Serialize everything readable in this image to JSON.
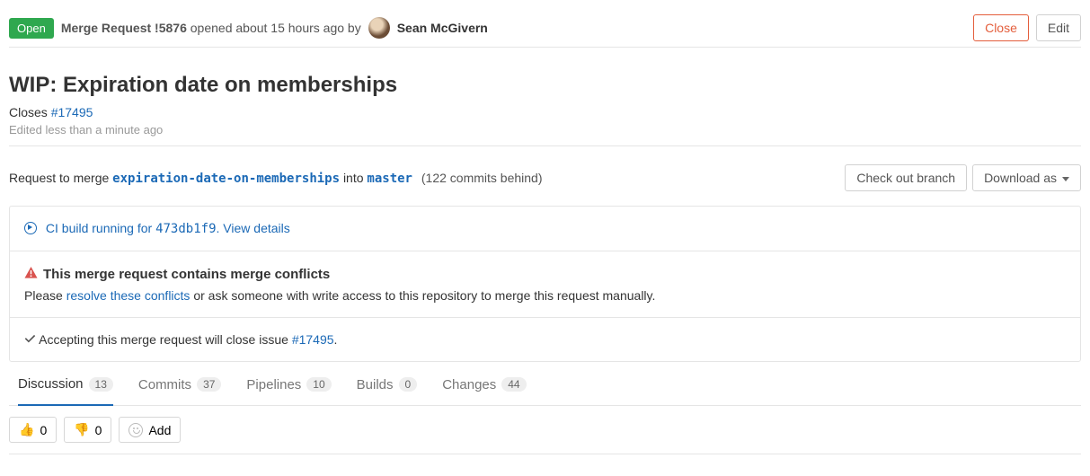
{
  "header": {
    "status": "Open",
    "label": "Merge Request !5876",
    "meta": "opened about 15 hours ago by",
    "author": "Sean McGivern",
    "close": "Close",
    "edit": "Edit"
  },
  "title": "WIP: Expiration date on memberships",
  "closes": {
    "prefix": "Closes ",
    "issue": "#17495"
  },
  "edited": "Edited less than a minute ago",
  "merge": {
    "prefix": "Request to merge ",
    "source": "expiration-date-on-memberships",
    "into": " into ",
    "target": "master",
    "behind": "(122 commits behind)",
    "checkout": "Check out branch",
    "download": "Download as"
  },
  "ci": {
    "text": "CI build running for ",
    "sha": "473db1f9",
    "details": ". View details"
  },
  "conflict": {
    "title": "This merge request contains merge conflicts",
    "please": "Please ",
    "resolve": "resolve these conflicts",
    "rest": " or ask someone with write access to this repository to merge this request manually."
  },
  "accept": {
    "prefix": "Accepting this merge request will close issue ",
    "issue": "#17495",
    "suffix": "."
  },
  "tabs": {
    "discussion": {
      "label": "Discussion",
      "count": "13"
    },
    "commits": {
      "label": "Commits",
      "count": "37"
    },
    "pipelines": {
      "label": "Pipelines",
      "count": "10"
    },
    "builds": {
      "label": "Builds",
      "count": "0"
    },
    "changes": {
      "label": "Changes",
      "count": "44"
    }
  },
  "reactions": {
    "thumbsup": "0",
    "thumbsdown": "0",
    "add": "Add"
  }
}
